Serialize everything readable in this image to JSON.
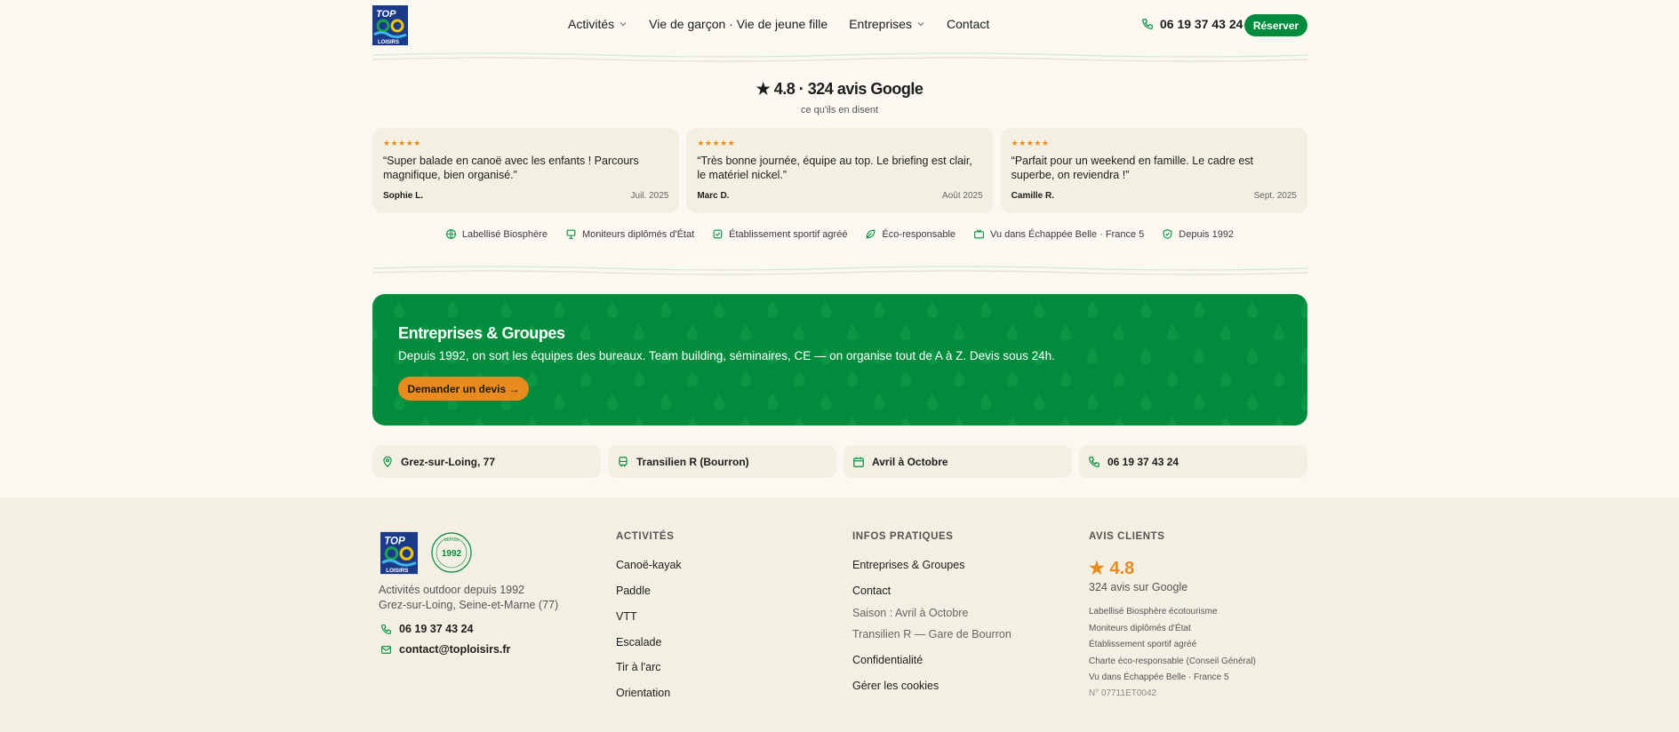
{
  "colors": {
    "brand_green": "#008c3c",
    "accent_orange": "#e88a1e",
    "cream": "#faf8f1",
    "card": "#f3efe3"
  },
  "header": {
    "nav": [
      {
        "label": "Activités",
        "has_dropdown": true
      },
      {
        "label": "Vie de garçon · Vie de jeune fille",
        "has_dropdown": false
      },
      {
        "label": "Entreprises",
        "has_dropdown": true
      },
      {
        "label": "Contact",
        "has_dropdown": false
      }
    ],
    "phone": "06 19 37 43 24",
    "reserve_label": "Réserver"
  },
  "reviews": {
    "title": "★ 4.8 · 324 avis Google",
    "subtitle": "ce qu'ils en disent",
    "items": [
      {
        "stars": "★★★★★",
        "text": "“Super balade en canoë avec les enfants ! Parcours magnifique, bien organisé.”",
        "author": "Sophie L.",
        "date": "Juil. 2025"
      },
      {
        "stars": "★★★★★",
        "text": "“Très bonne journée, équipe au top. Le briefing est clair, le matériel nickel.”",
        "author": "Marc D.",
        "date": "Août 2025"
      },
      {
        "stars": "★★★★★",
        "text": "“Parfait pour un weekend en famille. Le cadre est superbe, on reviendra !”",
        "author": "Camille R.",
        "date": "Sept. 2025"
      }
    ]
  },
  "badges": [
    {
      "icon": "globe-icon",
      "label": "Labellisé Biosphère"
    },
    {
      "icon": "instructor-icon",
      "label": "Moniteurs diplômés d'État"
    },
    {
      "icon": "check-square-icon",
      "label": "Établissement sportif agréé"
    },
    {
      "icon": "leaf-icon",
      "label": "Éco-responsable"
    },
    {
      "icon": "tv-icon",
      "label": "Vu dans Échappée Belle · France 5"
    },
    {
      "icon": "shield-check-icon",
      "label": "Depuis 1992"
    }
  ],
  "banner": {
    "title": "Entreprises & Groupes",
    "text": "Depuis 1992, on sort les équipes des bureaux. Team building, séminaires, CE — on organise tout de A à Z. Devis sous 24h.",
    "cta": "Demander un devis →"
  },
  "info_pills": [
    {
      "icon": "map-pin-icon",
      "label": "Grez-sur-Loing, 77"
    },
    {
      "icon": "train-icon",
      "label": "Transilien R (Bourron)"
    },
    {
      "icon": "calendar-icon",
      "label": "Avril à Octobre"
    },
    {
      "icon": "phone-icon",
      "label": "06 19 37 43 24"
    }
  ],
  "footer": {
    "seal_top": "DEPUIS",
    "seal_year": "1992",
    "about_line1": "Activités outdoor depuis 1992",
    "about_line2": "Grez-sur-Loing, Seine-et-Marne (77)",
    "phone": "06 19 37 43 24",
    "email": "contact@toploisirs.fr",
    "activities": {
      "heading": "ACTIVITÉS",
      "links": [
        "Canoë-kayak",
        "Paddle",
        "VTT",
        "Escalade",
        "Tir à l'arc",
        "Orientation"
      ]
    },
    "infos": {
      "heading": "INFOS PRATIQUES",
      "link1": "Entreprises & Groupes",
      "link2": "Contact",
      "season": "Saison : Avril à Octobre",
      "transport": "Transilien R — Gare de Bourron",
      "link3": "Confidentialité",
      "link4": "Gérer les cookies"
    },
    "reviews": {
      "heading": "AVIS CLIENTS",
      "rating": "★ 4.8",
      "count": "324 avis sur Google",
      "labels": [
        "Labellisé Biosphère écotourisme",
        "Moniteurs diplômés d'État",
        "Établissement sportif agréé",
        "Charte éco-responsable (Conseil Général)",
        "Vu dans Échappée Belle · France 5"
      ],
      "number": "N° 07711ET0042"
    }
  }
}
